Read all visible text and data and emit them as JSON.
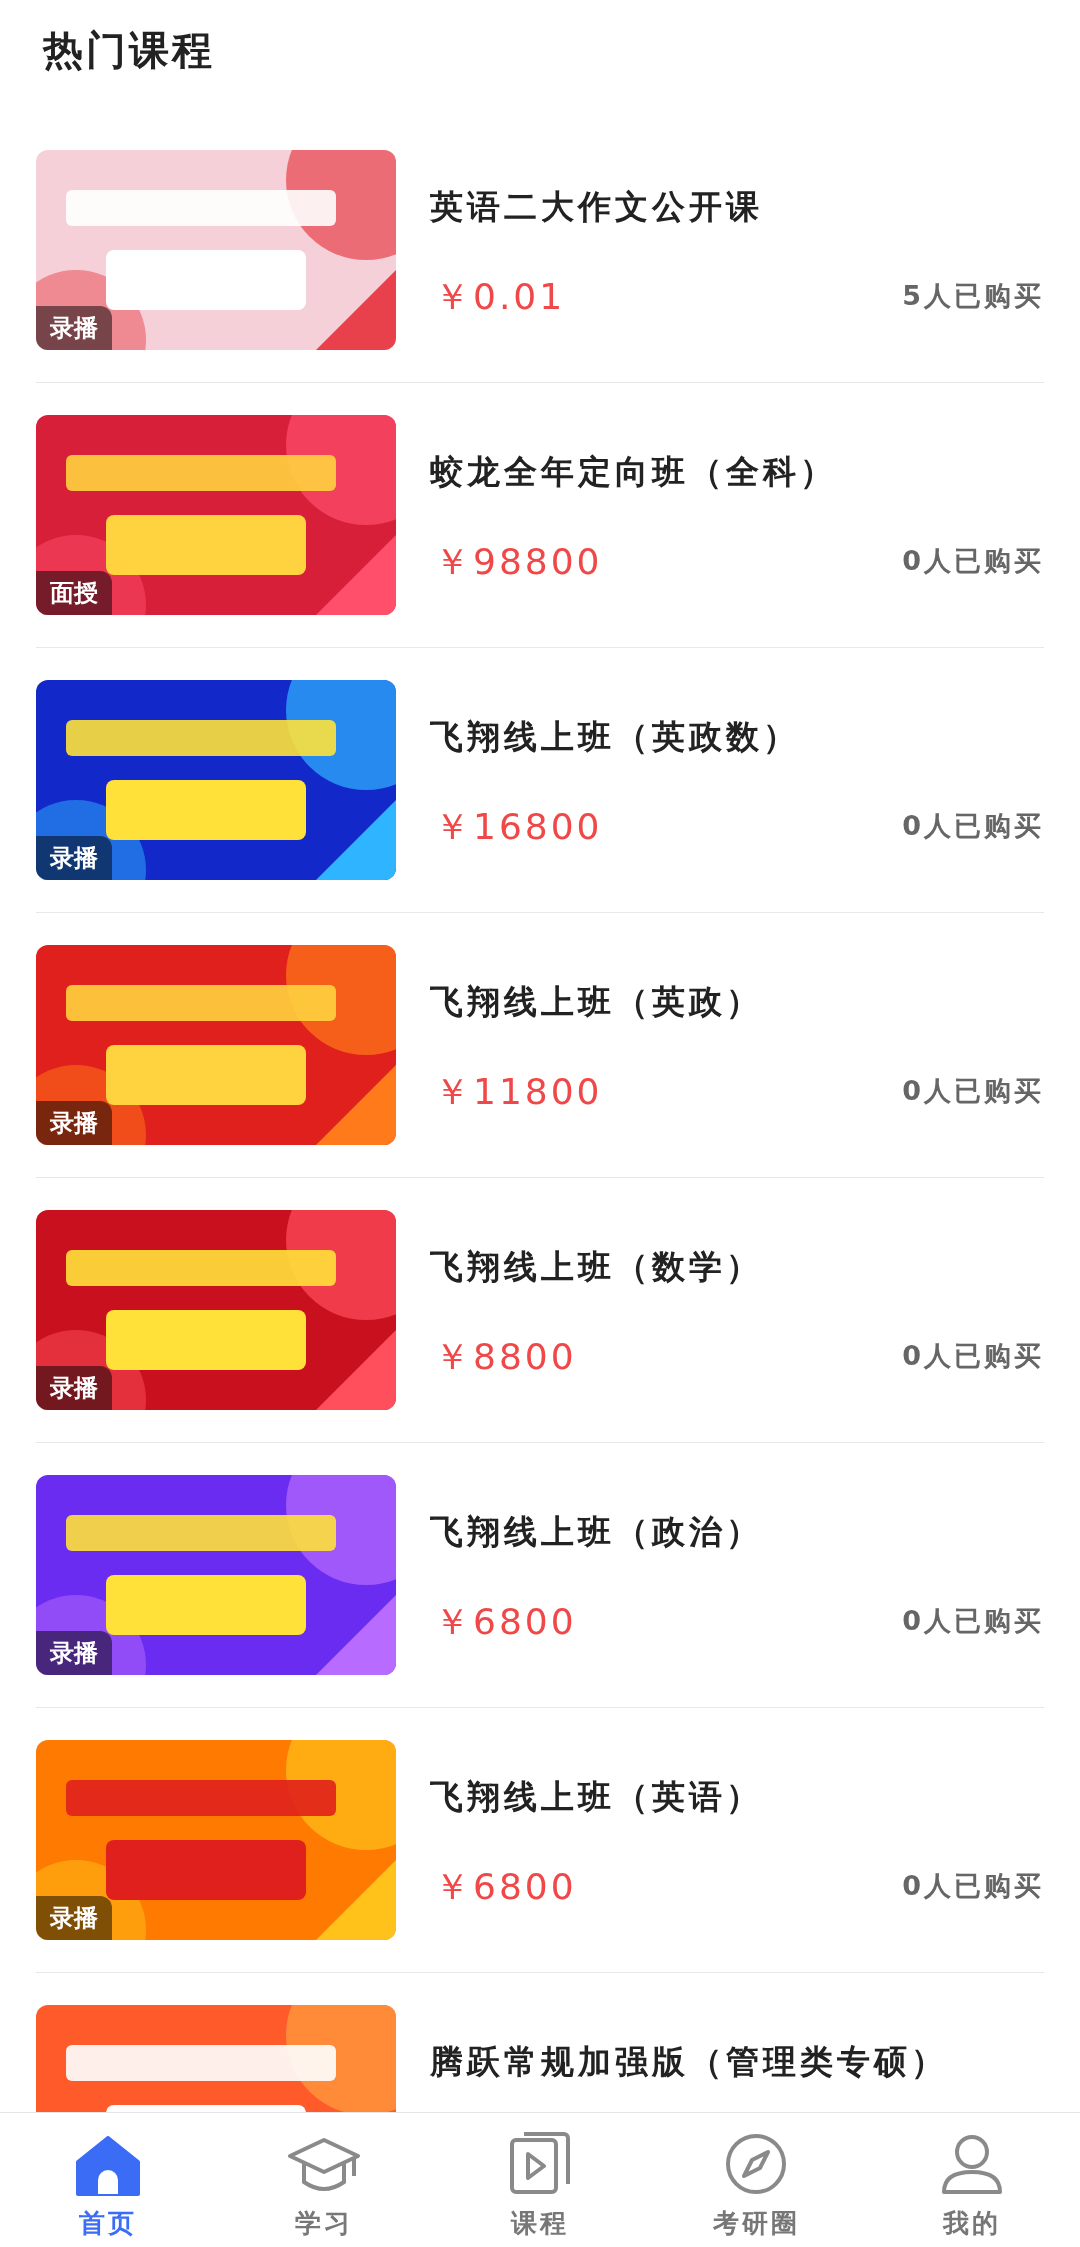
{
  "header": {
    "title": "热门课程"
  },
  "courses": [
    {
      "badge": "录播",
      "title": "英语二大作文公开课",
      "price": "￥0.01",
      "buyers": "5人已购买"
    },
    {
      "badge": "面授",
      "title": "蛟龙全年定向班（全科）",
      "price": "￥98800",
      "buyers": "0人已购买"
    },
    {
      "badge": "录播",
      "title": "飞翔线上班（英政数）",
      "price": "￥16800",
      "buyers": "0人已购买"
    },
    {
      "badge": "录播",
      "title": "飞翔线上班（英政）",
      "price": "￥11800",
      "buyers": "0人已购买"
    },
    {
      "badge": "录播",
      "title": "飞翔线上班（数学）",
      "price": "￥8800",
      "buyers": "0人已购买"
    },
    {
      "badge": "录播",
      "title": "飞翔线上班（政治）",
      "price": "￥6800",
      "buyers": "0人已购买"
    },
    {
      "badge": "录播",
      "title": "飞翔线上班（英语）",
      "price": "￥6800",
      "buyers": "0人已购买"
    },
    {
      "title": "腾跃常规加强版（管理类专硕）"
    }
  ],
  "bottom_nav": [
    {
      "kind": "home",
      "label": "首页",
      "selected": true
    },
    {
      "kind": "study",
      "label": "学习",
      "selected": false
    },
    {
      "kind": "course",
      "label": "课程",
      "selected": false
    },
    {
      "kind": "explore",
      "label": "考研圈",
      "selected": false
    },
    {
      "kind": "profile",
      "label": "我的",
      "selected": false
    }
  ]
}
